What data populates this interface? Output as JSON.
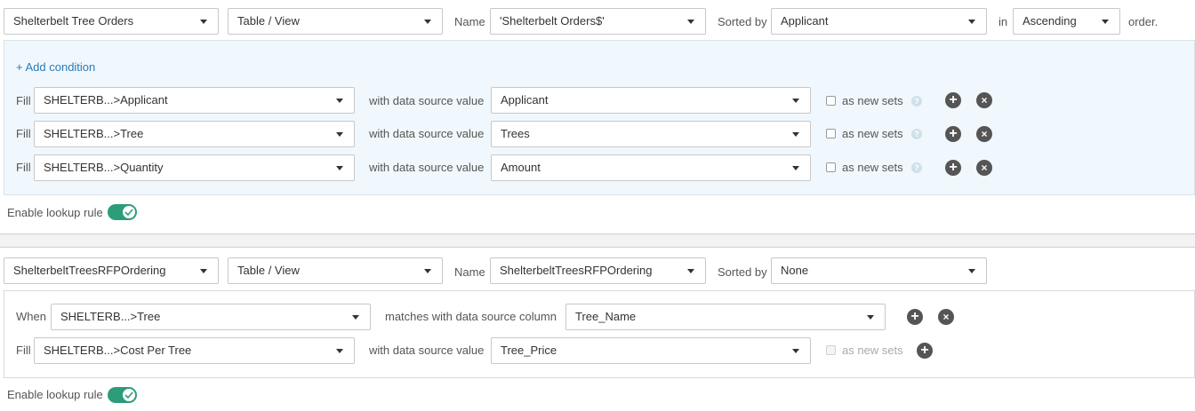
{
  "rule1": {
    "source": "Shelterbelt Tree Orders",
    "kind": "Table / View",
    "name_label": "Name",
    "name_value": "'Shelterbelt Orders$'",
    "sorted_label": "Sorted by",
    "sorted_value": "Applicant",
    "in_label": "in",
    "order_value": "Ascending",
    "order_suffix": "order.",
    "add_condition": "+ Add condition",
    "rows": [
      {
        "fill": "Fill",
        "field": "SHELTERB...>Applicant",
        "with": "with data source value",
        "value": "Applicant",
        "as_new": "as new sets"
      },
      {
        "fill": "Fill",
        "field": "SHELTERB...>Tree",
        "with": "with data source value",
        "value": "Trees",
        "as_new": "as new sets"
      },
      {
        "fill": "Fill",
        "field": "SHELTERB...>Quantity",
        "with": "with data source value",
        "value": "Amount",
        "as_new": "as new sets"
      }
    ],
    "enable_label": "Enable lookup rule"
  },
  "rule2": {
    "source": "ShelterbeltTreesRFPOrdering",
    "kind": "Table / View",
    "name_label": "Name",
    "name_value": "ShelterbeltTreesRFPOrdering",
    "sorted_label": "Sorted by",
    "sorted_value": "None",
    "when_label": "When",
    "when_field": "SHELTERB...>Tree",
    "matches_label": "matches with data source column",
    "match_column": "Tree_Name",
    "fill_row": {
      "fill": "Fill",
      "field": "SHELTERB...>Cost Per Tree",
      "with": "with data source value",
      "value": "Tree_Price",
      "as_new": "as new sets"
    },
    "enable_label": "Enable lookup rule"
  },
  "icons": {
    "help": "?",
    "plus": "+",
    "close": "×"
  },
  "colors": {
    "accent": "#2d9c7b",
    "link": "#2a7ab8",
    "panel": "#f0f8fd"
  }
}
